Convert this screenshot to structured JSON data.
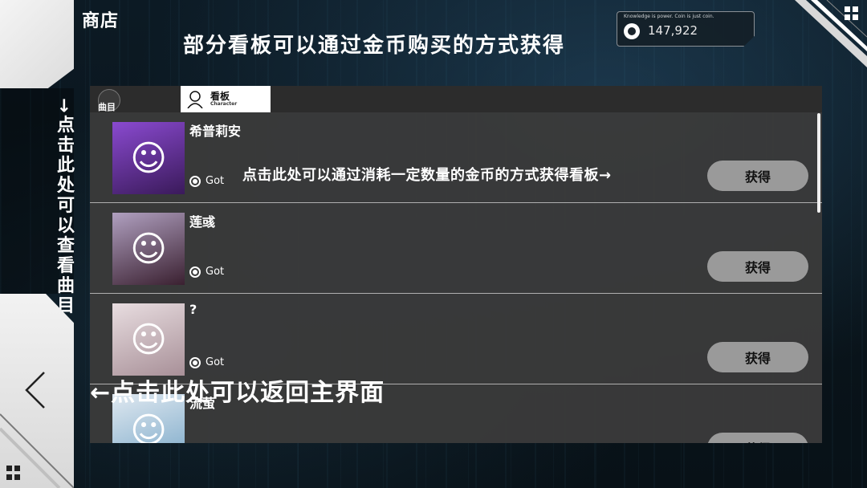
{
  "header": {
    "title": "商店",
    "tip": "部分看板可以通过金币购买的方式获得"
  },
  "coins": {
    "motto": "Knowledge is power. Coin is just coin.",
    "value": "147,922"
  },
  "left": {
    "songs_tip": "→点击此处可以查看曲目",
    "back_tip": "←点击此处可以返回主界面"
  },
  "tabs": {
    "songs_label": "曲目",
    "char_label": "看板",
    "char_sub": "Character"
  },
  "characters": [
    {
      "name": "希普莉安",
      "status": "Got",
      "button": "获得",
      "portrait_bg": "#6a3a9a"
    },
    {
      "name": "莲彧",
      "status": "Got",
      "button": "获得",
      "portrait_bg": "#4a2a4a"
    },
    {
      "name": "?",
      "status": "Got",
      "button": "获得",
      "portrait_bg": "#c8b8c0"
    },
    {
      "name": "流萤",
      "status": "",
      "button": "获得",
      "portrait_bg": "#a8c4d8"
    }
  ],
  "row_tip": "点击此处可以通过消耗一定数量的金币的方式获得看板→",
  "icons": {
    "menu": "grid-menu-icon",
    "back": "chevron-left-icon",
    "coin": "coin-icon",
    "radio": "radio-icon",
    "avatar": "character-silhouette-icon"
  }
}
